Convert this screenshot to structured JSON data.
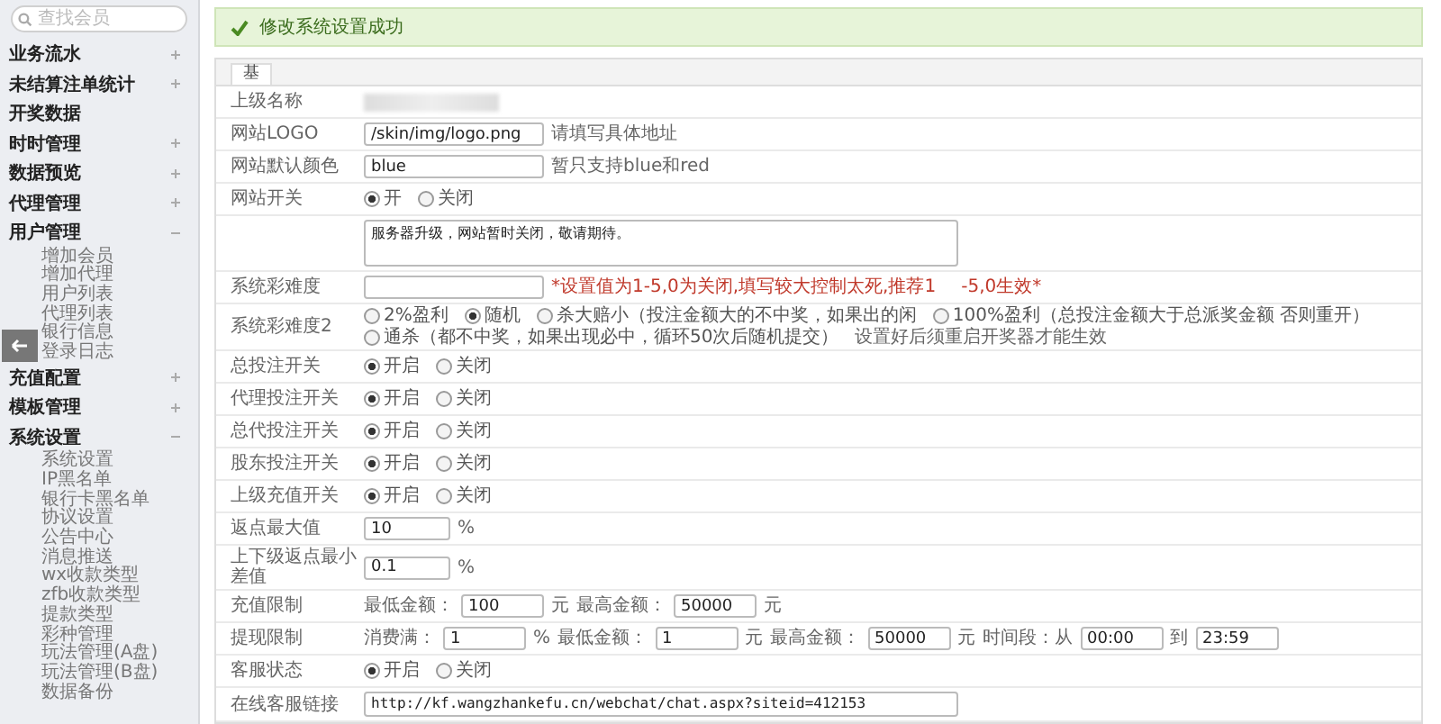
{
  "sidebar": {
    "search": {
      "placeholder": "查找会员"
    },
    "groups": [
      {
        "label": "业务流水",
        "expanded": false
      },
      {
        "label": "未结算注单统计",
        "expanded": false
      },
      {
        "label": "开奖数据"
      },
      {
        "label": "时时管理",
        "expanded": false
      },
      {
        "label": "数据预览",
        "expanded": false
      },
      {
        "label": "代理管理",
        "expanded": false
      },
      {
        "label": "用户管理",
        "expanded": true,
        "children": [
          "增加会员",
          "增加代理",
          "用户列表",
          "代理列表",
          "银行信息",
          "登录日志"
        ]
      },
      {
        "label": "充值配置",
        "expanded": false
      },
      {
        "label": "模板管理",
        "expanded": false
      },
      {
        "label": "系统设置",
        "expanded": true,
        "children": [
          "系统设置",
          "IP黑名单",
          "银行卡黑名单",
          "协议设置",
          "公告中心",
          "消息推送",
          "wx收款类型",
          "zfb收款类型",
          "提款类型",
          "彩种管理",
          "玩法管理(A盘)",
          "玩法管理(B盘)",
          "数据备份"
        ]
      }
    ]
  },
  "alert": {
    "text": "修改系统设置成功"
  },
  "tab": {
    "label": "基"
  },
  "rows": [
    {
      "kind": "redacted",
      "label": "上级名称"
    },
    {
      "kind": "inputs",
      "label": "网站LOGO",
      "parts": [
        {
          "value": "/skin/img/logo.png"
        }
      ],
      "hints": [
        {
          "text": "请填写具体地址",
          "color": "#666666"
        }
      ]
    },
    {
      "kind": "inputs",
      "label": "网站默认颜色",
      "parts": [
        {
          "value": "blue"
        }
      ],
      "hints": [
        {
          "text": "暂只支持blue和red",
          "color": "#666666"
        }
      ]
    },
    {
      "kind": "radio",
      "label": "网站开关",
      "options": [
        {
          "label": "开",
          "selected": true
        },
        {
          "label": "关闭",
          "selected": false
        }
      ]
    },
    {
      "kind": "textarea",
      "value": "服务器升级，网站暂时关闭，敬请期待。"
    },
    {
      "kind": "inputs",
      "label": "系统彩难度",
      "hints": [
        {
          "text": "*设置值为1-5,0为关闭,填写较大控制太死,推荐1",
          "color": "#c0392b"
        },
        {
          "text": "-5,0生效*",
          "color": "#c0392b"
        }
      ]
    },
    {
      "kind": "radio",
      "label": "系统彩难度2",
      "options": [
        {
          "label": "2%盈利",
          "selected": false
        },
        {
          "label": "随机",
          "selected": true
        },
        {
          "label": "杀大赔小（投注金额大的不中奖，如果出的闲",
          "selected": false
        },
        {
          "label": "100%盈利（总投注金额大于总派奖金额 否则重开）",
          "selected": false
        },
        {
          "label": "通杀（都不中奖，如果出现必中，循环50次后随机提交）",
          "selected": false
        }
      ],
      "note": "设置好后须重启开奖器才能生效"
    },
    {
      "kind": "radio",
      "label": "总投注开关",
      "options": [
        {
          "label": "开启",
          "selected": true
        },
        {
          "label": "关闭",
          "selected": false
        }
      ]
    },
    {
      "kind": "radio",
      "label": "代理投注开关",
      "options": [
        {
          "label": "开启",
          "selected": true
        },
        {
          "label": "关闭",
          "selected": false
        }
      ]
    },
    {
      "kind": "radio",
      "label": "总代投注开关",
      "options": [
        {
          "label": "开启",
          "selected": true
        },
        {
          "label": "关闭",
          "selected": false
        }
      ]
    },
    {
      "kind": "radio",
      "label": "股东投注开关",
      "options": [
        {
          "label": "开启",
          "selected": true
        },
        {
          "label": "关闭",
          "selected": false
        }
      ]
    },
    {
      "kind": "radio",
      "label": "上级充值开关",
      "options": [
        {
          "label": "开启",
          "selected": true
        },
        {
          "label": "关闭",
          "selected": false
        }
      ]
    },
    {
      "kind": "inputs",
      "label": "返点最大值",
      "parts": [
        {
          "value": "10",
          "unit": "%"
        }
      ]
    },
    {
      "kind": "inputs",
      "label": "上下级返点最小差值",
      "parts": [
        {
          "value": "0.1",
          "unit": "%"
        }
      ]
    },
    {
      "kind": "inputs",
      "label": "充值限制",
      "parts": [
        {
          "prefix": "最低金额：",
          "value": "100",
          "unit": "元"
        },
        {
          "prefix": "最高金额：",
          "value": "50000",
          "unit": "元"
        }
      ]
    },
    {
      "kind": "inputs",
      "label": "提现限制",
      "parts": [
        {
          "prefix": "消费满：",
          "value": "1",
          "unit": "%"
        },
        {
          "prefix": "最低金额：",
          "value": "1",
          "unit": "元"
        },
        {
          "prefix": "最高金额：",
          "value": "50000",
          "unit": "元"
        },
        {
          "prefix": "时间段：从",
          "value": "00:00"
        },
        {
          "prefix": "到",
          "value": "23:59"
        }
      ]
    },
    {
      "kind": "radio",
      "label": "客服状态",
      "options": [
        {
          "label": "开启",
          "selected": true
        },
        {
          "label": "关闭",
          "selected": false
        }
      ]
    },
    {
      "kind": "textarea",
      "label": "在线客服链接",
      "value": "http://kf.wangzhankefu.cn/webchat/chat.aspx?siteid=412153"
    }
  ]
}
